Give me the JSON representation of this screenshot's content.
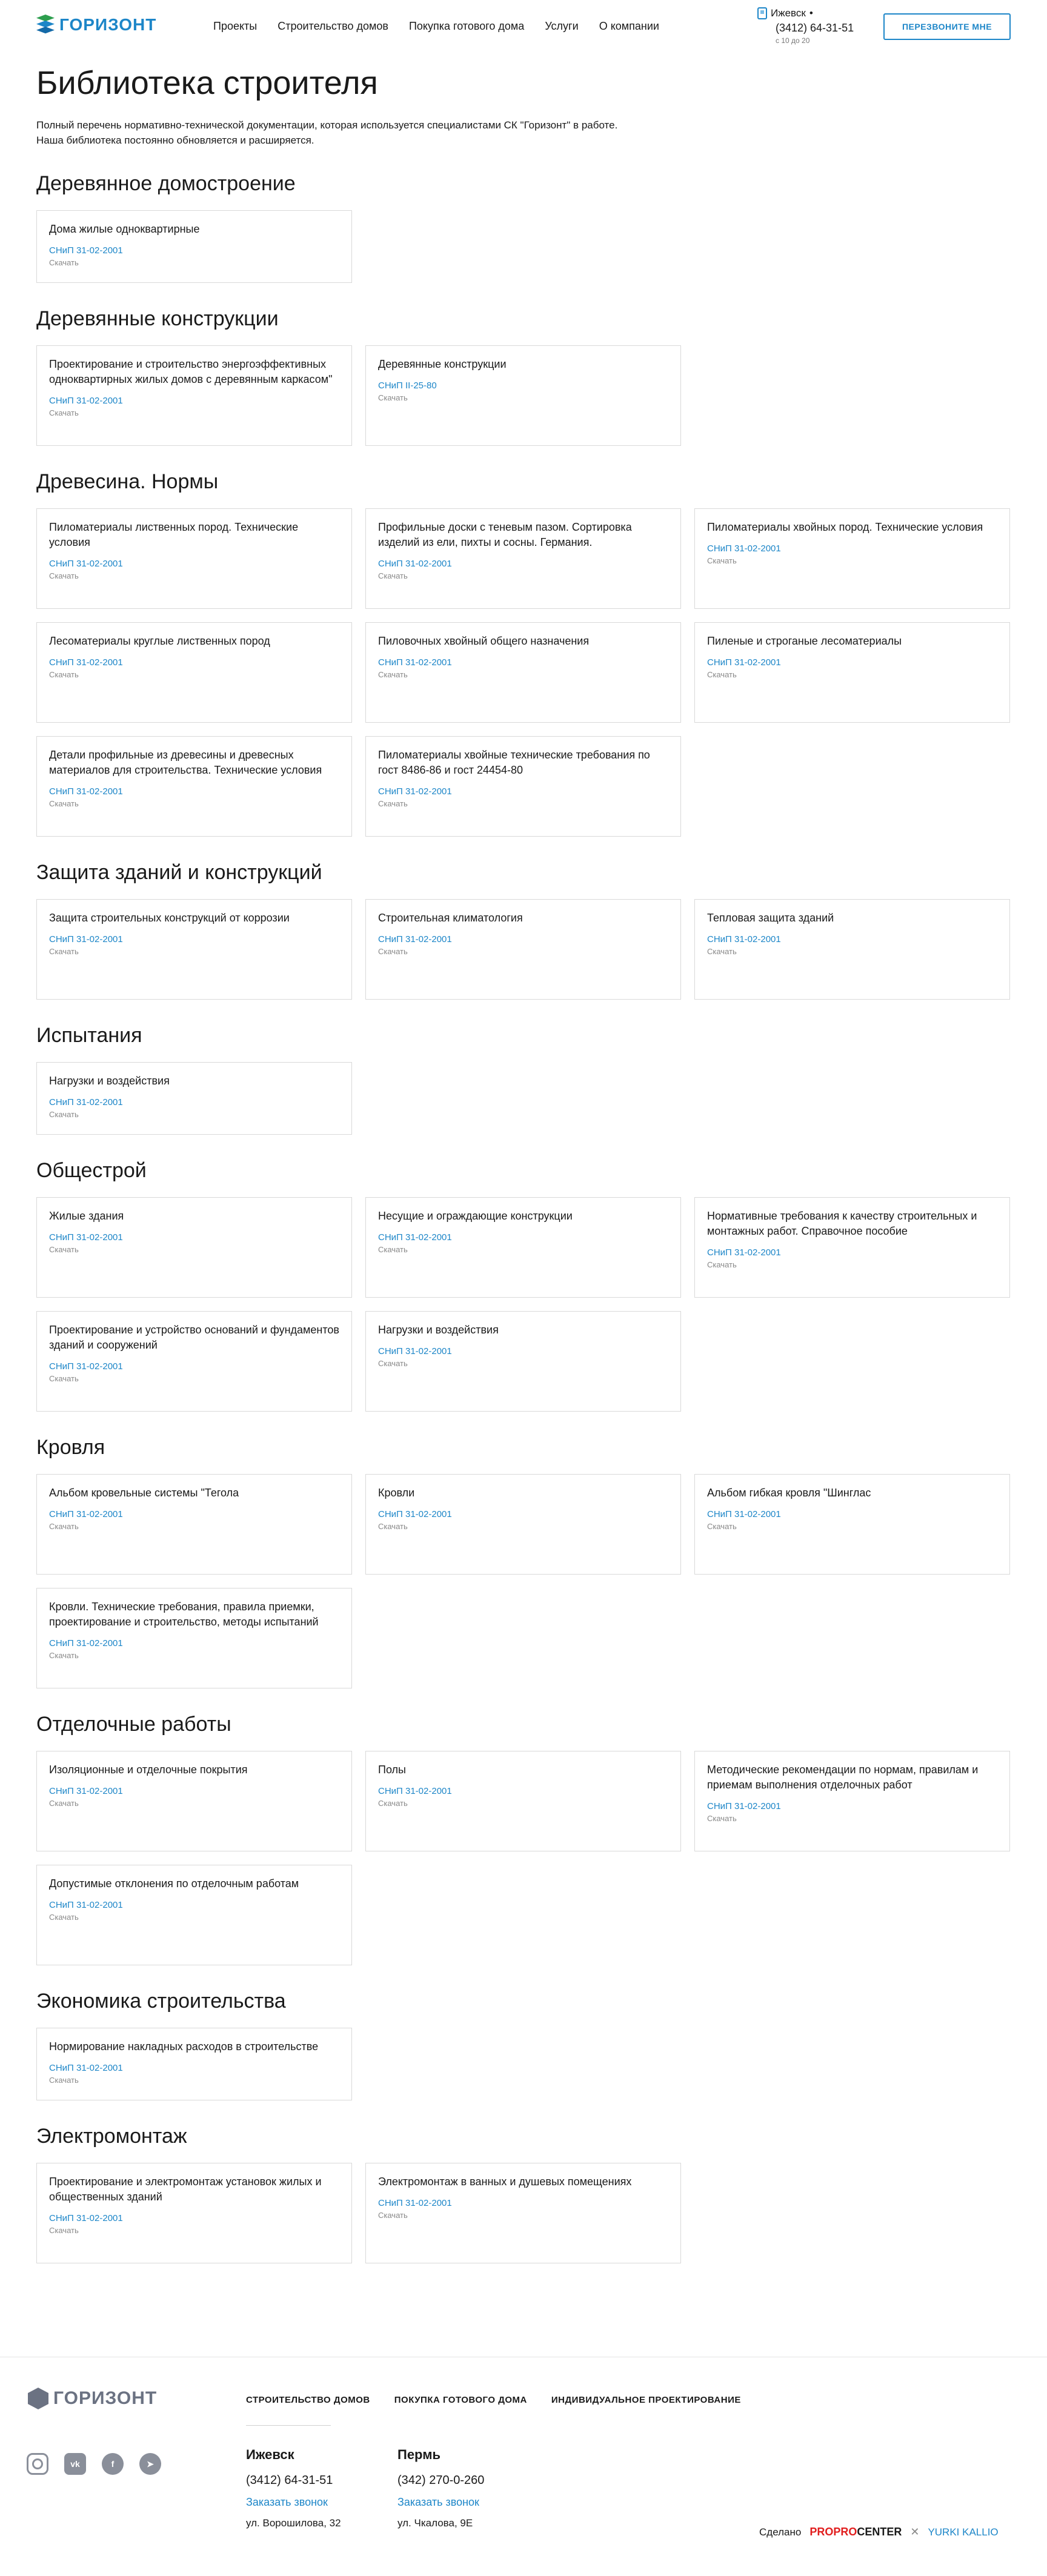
{
  "header": {
    "logo_text": "ГОРИЗОНТ",
    "nav": [
      "Проекты",
      "Строительство домов",
      "Покупка готового дома",
      "Услуги",
      "О компании"
    ],
    "city": "Ижевск",
    "city_caret": "•",
    "phone": "(3412) 64-31-51",
    "hours": "с 10 до 20",
    "callback_label": "ПЕРЕЗВОНИТЕ МНЕ"
  },
  "main": {
    "title": "Библиотека строителя",
    "intro": "Полный перечень нормативно-технической документации, которая используется специалистами СК \"Горизонт\" в работе. Наша библиотека постоянно обновляется и расширяется.",
    "download_label": "Скачать",
    "sections": [
      {
        "title": "Деревянное домостроение",
        "cards": [
          {
            "title": "Дома жилые одноквартирные",
            "code": "СНиП 31-02-2001"
          }
        ]
      },
      {
        "title": "Деревянные конструкции",
        "cards": [
          {
            "title": "Проектирование и строительство энергоэффективных одноквартирных жилых домов с деревянным каркасом\"",
            "code": "СНиП 31-02-2001"
          },
          {
            "title": "Деревянные конструкции",
            "code": "СНиП II-25-80"
          }
        ]
      },
      {
        "title": "Древесина. Нормы",
        "cards": [
          {
            "title": "Пиломатериалы лиственных пород. Технические условия",
            "code": "СНиП 31-02-2001"
          },
          {
            "title": "Профильные доски с теневым пазом. Сортировка изделий из ели, пихты и сосны. Германия.",
            "code": "СНиП 31-02-2001"
          },
          {
            "title": "Пиломатериалы хвойных пород. Технические условия",
            "code": "СНиП 31-02-2001"
          },
          {
            "title": "Лесоматериалы круглые лиственных пород",
            "code": "СНиП 31-02-2001"
          },
          {
            "title": "Пиловочных хвойный общего назначения",
            "code": "СНиП 31-02-2001"
          },
          {
            "title": "Пиленые и строганые лесоматериалы",
            "code": "СНиП 31-02-2001"
          },
          {
            "title": "Детали профильные из древесины и древесных материалов для строительства. Технические условия",
            "code": "СНиП 31-02-2001"
          },
          {
            "title": "Пиломатериалы хвойные технические требования по гост 8486-86 и гост 24454-80",
            "code": "СНиП 31-02-2001"
          }
        ]
      },
      {
        "title": "Защита зданий и конструкций",
        "cards": [
          {
            "title": "Защита строительных конструкций от коррозии",
            "code": "СНиП 31-02-2001"
          },
          {
            "title": "Строительная климатология",
            "code": "СНиП 31-02-2001"
          },
          {
            "title": "Тепловая защита зданий",
            "code": "СНиП 31-02-2001"
          }
        ]
      },
      {
        "title": "Испытания",
        "cards": [
          {
            "title": "Нагрузки и воздействия",
            "code": "СНиП 31-02-2001"
          }
        ]
      },
      {
        "title": "Общестрой",
        "cards": [
          {
            "title": "Жилые здания",
            "code": "СНиП 31-02-2001"
          },
          {
            "title": "Несущие и ограждающие конструкции",
            "code": "СНиП 31-02-2001"
          },
          {
            "title": "Нормативные требования к качеству строительных и монтажных работ. Справочное пособие",
            "code": "СНиП 31-02-2001"
          },
          {
            "title": "Проектирование и устройство оснований и фундаментов зданий и сооружений",
            "code": "СНиП 31-02-2001"
          },
          {
            "title": "Нагрузки и воздействия",
            "code": "СНиП 31-02-2001"
          }
        ]
      },
      {
        "title": "Кровля",
        "cards": [
          {
            "title": "Альбом кровельные системы  \"Тегола",
            "code": "СНиП 31-02-2001"
          },
          {
            "title": "Кровли",
            "code": "СНиП 31-02-2001"
          },
          {
            "title": "Альбом гибкая кровля \"Шинглас",
            "code": "СНиП 31-02-2001"
          },
          {
            "title": "Кровли. Технические требования, правила приемки, проектирование и строительство, методы испытаний",
            "code": "СНиП 31-02-2001"
          }
        ]
      },
      {
        "title": "Отделочные работы",
        "cards": [
          {
            "title": "Изоляционные и отделочные покрытия",
            "code": "СНиП 31-02-2001"
          },
          {
            "title": "Полы",
            "code": "СНиП 31-02-2001"
          },
          {
            "title": "Методические рекомендации по нормам, правилам и приемам выполнения отделочных работ",
            "code": "СНиП 31-02-2001"
          },
          {
            "title": "Допустимые отклонения по отделочным работам",
            "code": "СНиП 31-02-2001"
          }
        ]
      },
      {
        "title": "Экономика строительства",
        "cards": [
          {
            "title": "Нормирование накладных расходов в строительстве",
            "code": "СНиП 31-02-2001"
          }
        ]
      },
      {
        "title": "Электромонтаж",
        "cards": [
          {
            "title": "Проектирование и электромонтаж установок жилых и общественных зданий",
            "code": "СНиП 31-02-2001"
          },
          {
            "title": "Электромонтаж в ванных и душевых помещениях",
            "code": "СНиП 31-02-2001"
          }
        ]
      }
    ]
  },
  "footer": {
    "logo_text": "ГОРИЗОНТ",
    "nav": [
      "СТРОИТЕЛЬСТВО ДОМОВ",
      "ПОКУПКА ГОТОВОГО ДОМА",
      "ИНДИВИДУАЛЬНОЕ ПРОЕКТИРОВАНИЕ"
    ],
    "offices": [
      {
        "city": "Ижевск",
        "phone": "(3412) 64-31-51",
        "link": "Заказать звонок",
        "address": "ул. Ворошилова, 32"
      },
      {
        "city": "Пермь",
        "phone": "(342) 270-0-260",
        "link": "Заказать звонок",
        "address": "ул. Чкалова, 9Е"
      }
    ],
    "made_by": "Сделано",
    "partner_1a": "PROPRO",
    "partner_1b": "CENTER",
    "separator": "✕",
    "partner_2": "YURKI KALLIO"
  }
}
